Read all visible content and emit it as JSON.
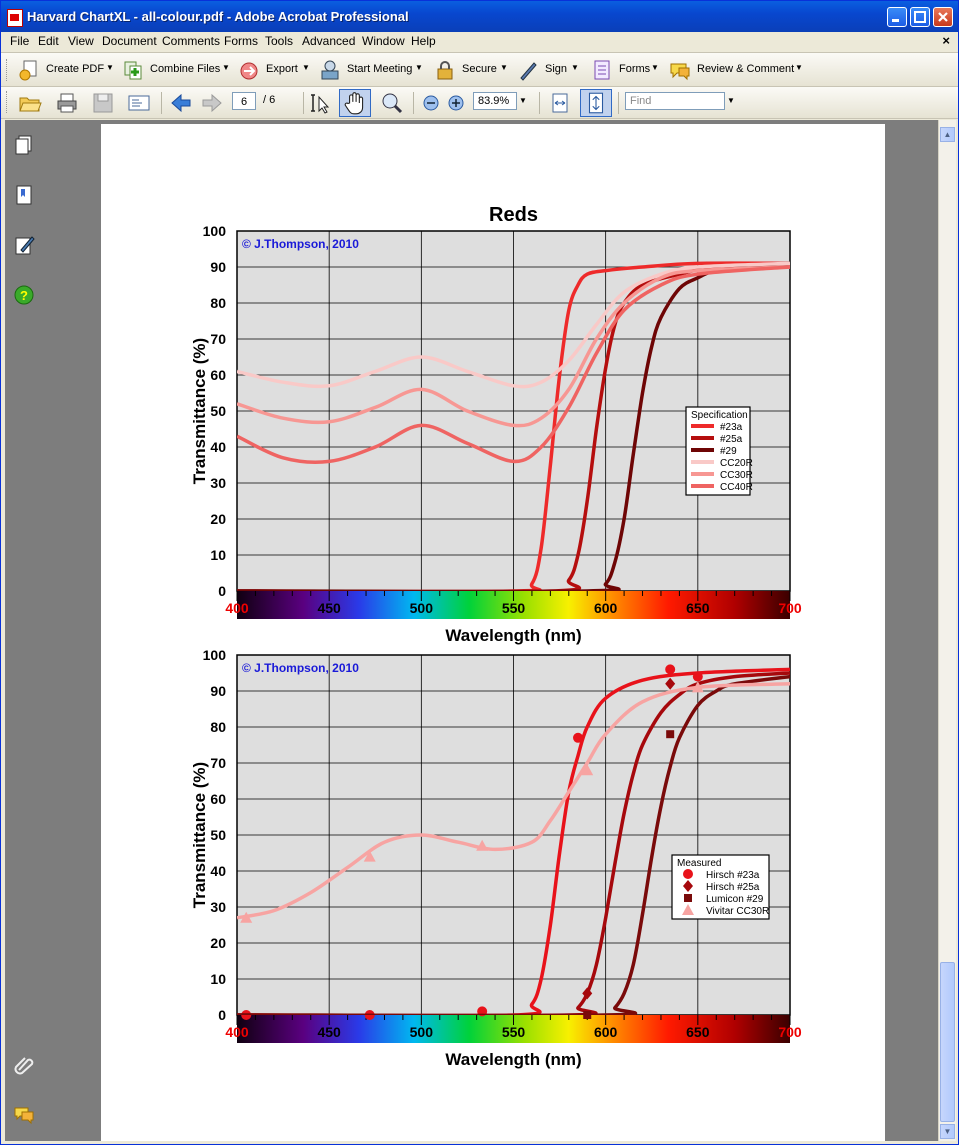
{
  "window": {
    "title": "Harvard ChartXL - all-colour.pdf - Adobe Acrobat Professional"
  },
  "menu": [
    "File",
    "Edit",
    "View",
    "Document",
    "Comments",
    "Forms",
    "Tools",
    "Advanced",
    "Window",
    "Help"
  ],
  "menu_close": "×",
  "toolbar1": [
    "Create PDF",
    "Combine Files",
    "Export",
    "Start Meeting",
    "Secure",
    "Sign",
    "Forms",
    "Review & Comment"
  ],
  "toolbar2": {
    "page_current": "6",
    "page_total": "/ 6",
    "zoom": "83.9%",
    "find_placeholder": "Find"
  },
  "chart_data": [
    {
      "type": "line",
      "title": "Reds",
      "watermark": "© J.Thompson, 2010",
      "xlabel": "Wavelength (nm)",
      "ylabel": "Transmittance (%)",
      "xlim": [
        400,
        700
      ],
      "ylim": [
        0,
        100
      ],
      "x_ticks": [
        "400",
        "450",
        "500",
        "550",
        "600",
        "650",
        "700"
      ],
      "y_ticks": [
        "0",
        "10",
        "20",
        "30",
        "40",
        "50",
        "60",
        "70",
        "80",
        "90",
        "100"
      ],
      "grid": true,
      "legend_title": "Specification",
      "legend_position": "right",
      "series": [
        {
          "name": "#23a",
          "color": "#ee2a2a",
          "x": [
            400,
            550,
            560,
            565,
            570,
            575,
            580,
            585,
            590,
            600,
            620,
            650,
            700
          ],
          "y": [
            0,
            0,
            2,
            12,
            35,
            60,
            78,
            85,
            88,
            89,
            90,
            91,
            91
          ]
        },
        {
          "name": "#25a",
          "color": "#b50e0e",
          "x": [
            400,
            570,
            580,
            585,
            590,
            595,
            600,
            605,
            610,
            620,
            640,
            660,
            700
          ],
          "y": [
            0,
            0,
            3,
            10,
            25,
            45,
            62,
            74,
            80,
            85,
            88,
            90,
            91
          ]
        },
        {
          "name": "#29",
          "color": "#6e0505",
          "x": [
            400,
            590,
            600,
            605,
            610,
            615,
            620,
            625,
            630,
            640,
            650,
            660,
            680,
            700
          ],
          "y": [
            0,
            0,
            2,
            8,
            20,
            38,
            55,
            68,
            76,
            84,
            87,
            89,
            90,
            91
          ]
        },
        {
          "name": "CC20R",
          "color": "#f9c9c7",
          "x": [
            400,
            425,
            450,
            475,
            500,
            525,
            550,
            565,
            580,
            595,
            610,
            630,
            650,
            700
          ],
          "y": [
            61,
            58,
            57,
            61,
            65,
            61,
            57,
            58,
            64,
            74,
            83,
            88,
            90,
            91
          ]
        },
        {
          "name": "CC30R",
          "color": "#f79793",
          "x": [
            400,
            425,
            450,
            475,
            500,
            525,
            550,
            565,
            580,
            595,
            610,
            630,
            650,
            700
          ],
          "y": [
            52,
            48,
            47,
            51,
            56,
            50,
            46,
            48,
            56,
            70,
            80,
            87,
            89,
            90
          ]
        },
        {
          "name": "CC40R",
          "color": "#ef6462",
          "x": [
            400,
            425,
            450,
            475,
            500,
            525,
            550,
            565,
            580,
            595,
            610,
            630,
            650,
            700
          ],
          "y": [
            43,
            37,
            36,
            40,
            46,
            41,
            36,
            40,
            51,
            66,
            78,
            85,
            88,
            90
          ]
        }
      ]
    },
    {
      "type": "line",
      "watermark": "© J.Thompson, 2010",
      "xlabel": "Wavelength (nm)",
      "ylabel": "Transmittance (%)",
      "xlim": [
        400,
        700
      ],
      "ylim": [
        0,
        100
      ],
      "x_ticks": [
        "400",
        "450",
        "500",
        "550",
        "600",
        "650",
        "700"
      ],
      "y_ticks": [
        "0",
        "10",
        "20",
        "30",
        "40",
        "50",
        "60",
        "70",
        "80",
        "90",
        "100"
      ],
      "grid": true,
      "legend_title": "Measured",
      "legend_position": "right",
      "series": [
        {
          "name": "Hirsch #23a",
          "color": "#e8121a",
          "marker": "circle",
          "curve_x": [
            400,
            550,
            560,
            565,
            570,
            575,
            580,
            585,
            590,
            600,
            620,
            650,
            700
          ],
          "curve_y": [
            0,
            0,
            3,
            10,
            25,
            45,
            62,
            72,
            80,
            88,
            93,
            95,
            96
          ],
          "x": [
            405,
            472,
            533,
            585,
            635,
            650
          ],
          "y": [
            0,
            0,
            1,
            77,
            96,
            94
          ]
        },
        {
          "name": "Hirsch #25a",
          "color": "#a6080c",
          "marker": "diamond",
          "curve_x": [
            400,
            580,
            585,
            590,
            595,
            600,
            605,
            610,
            615,
            620,
            630,
            640,
            650,
            670,
            700
          ],
          "curve_y": [
            0,
            0,
            2,
            6,
            14,
            27,
            42,
            56,
            67,
            75,
            84,
            89,
            92,
            94,
            95
          ],
          "x": [
            590,
            635
          ],
          "y": [
            6,
            92
          ]
        },
        {
          "name": "Lumicon #29",
          "color": "#7a0a0a",
          "marker": "square",
          "curve_x": [
            400,
            600,
            605,
            610,
            615,
            620,
            625,
            630,
            635,
            640,
            650,
            660,
            670,
            700
          ],
          "curve_y": [
            0,
            0,
            2,
            6,
            14,
            28,
            44,
            58,
            69,
            77,
            86,
            90,
            92,
            94
          ],
          "x": [
            590,
            635
          ],
          "y": [
            0,
            78
          ]
        },
        {
          "name": "Vivitar CC30R",
          "color": "#f7a4a2",
          "marker": "triangle",
          "curve_x": [
            400,
            420,
            440,
            460,
            480,
            500,
            520,
            540,
            560,
            570,
            580,
            590,
            600,
            620,
            650,
            700
          ],
          "curve_y": [
            27,
            29,
            34,
            41,
            48,
            50,
            48,
            46,
            48,
            54,
            62,
            70,
            78,
            87,
            91,
            92
          ],
          "x": [
            405,
            472,
            533,
            590,
            650
          ],
          "y": [
            27,
            44,
            47,
            68,
            91
          ]
        }
      ]
    }
  ]
}
